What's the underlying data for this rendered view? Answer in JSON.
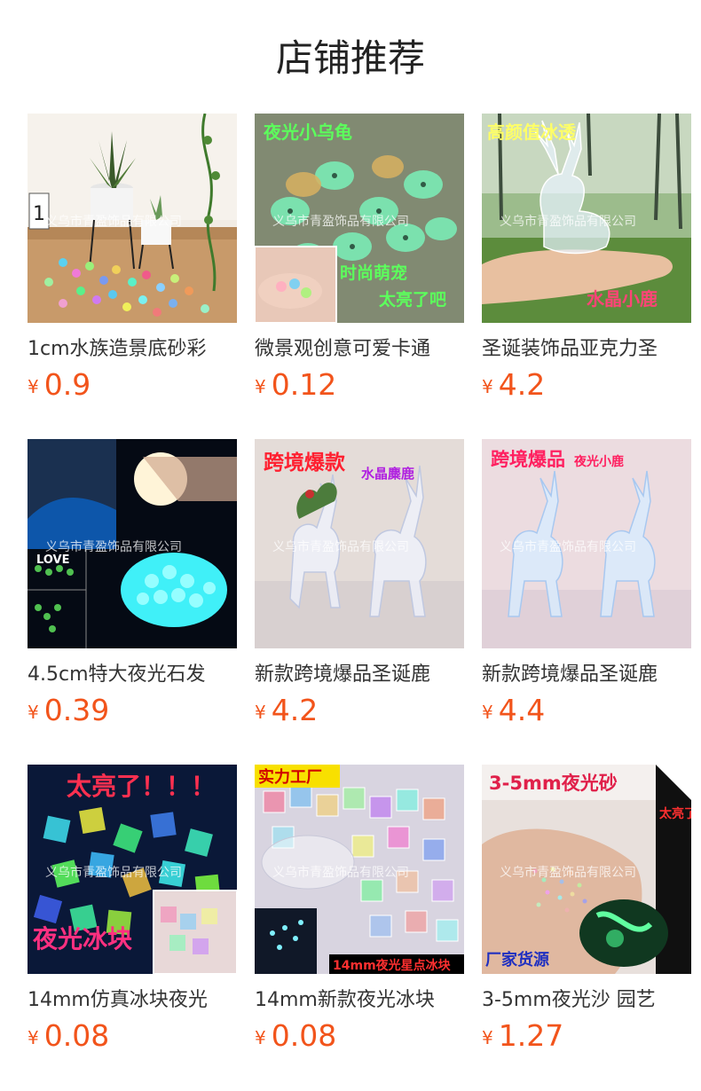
{
  "header": {
    "title": "店铺推荐"
  },
  "watermark": "义乌市青盈饰品有限公司",
  "currency": "¥",
  "products": [
    {
      "name": "1cm水族造景底砂彩",
      "price": "0.9",
      "overlay": []
    },
    {
      "name": "微景观创意可爱卡通",
      "price": "0.12",
      "overlay": [
        "夜光小乌龟",
        "时尚萌宠",
        "太亮了吧"
      ]
    },
    {
      "name": "圣诞装饰品亚克力圣",
      "price": "4.2",
      "overlay": [
        "高颜值冰透",
        "水晶小鹿"
      ]
    },
    {
      "name": "4.5cm特大夜光石发",
      "price": "0.39",
      "overlay": [
        "LOVE"
      ]
    },
    {
      "name": "新款跨境爆品圣诞鹿",
      "price": "4.2",
      "overlay": [
        "跨境爆款",
        "水晶麋鹿"
      ]
    },
    {
      "name": "新款跨境爆品圣诞鹿",
      "price": "4.4",
      "overlay": [
        "跨境爆品",
        "夜光小鹿"
      ]
    },
    {
      "name": "14mm仿真冰块夜光",
      "price": "0.08",
      "overlay": [
        "太亮了！！！",
        "夜光冰块"
      ]
    },
    {
      "name": "14mm新款夜光冰块",
      "price": "0.08",
      "overlay": [
        "实力工厂",
        "14mm夜光星点冰块"
      ]
    },
    {
      "name": "3-5mm夜光沙 园艺",
      "price": "1.27",
      "overlay": [
        "3-5mm夜光砂",
        "太亮了",
        "厂家货源"
      ]
    }
  ]
}
